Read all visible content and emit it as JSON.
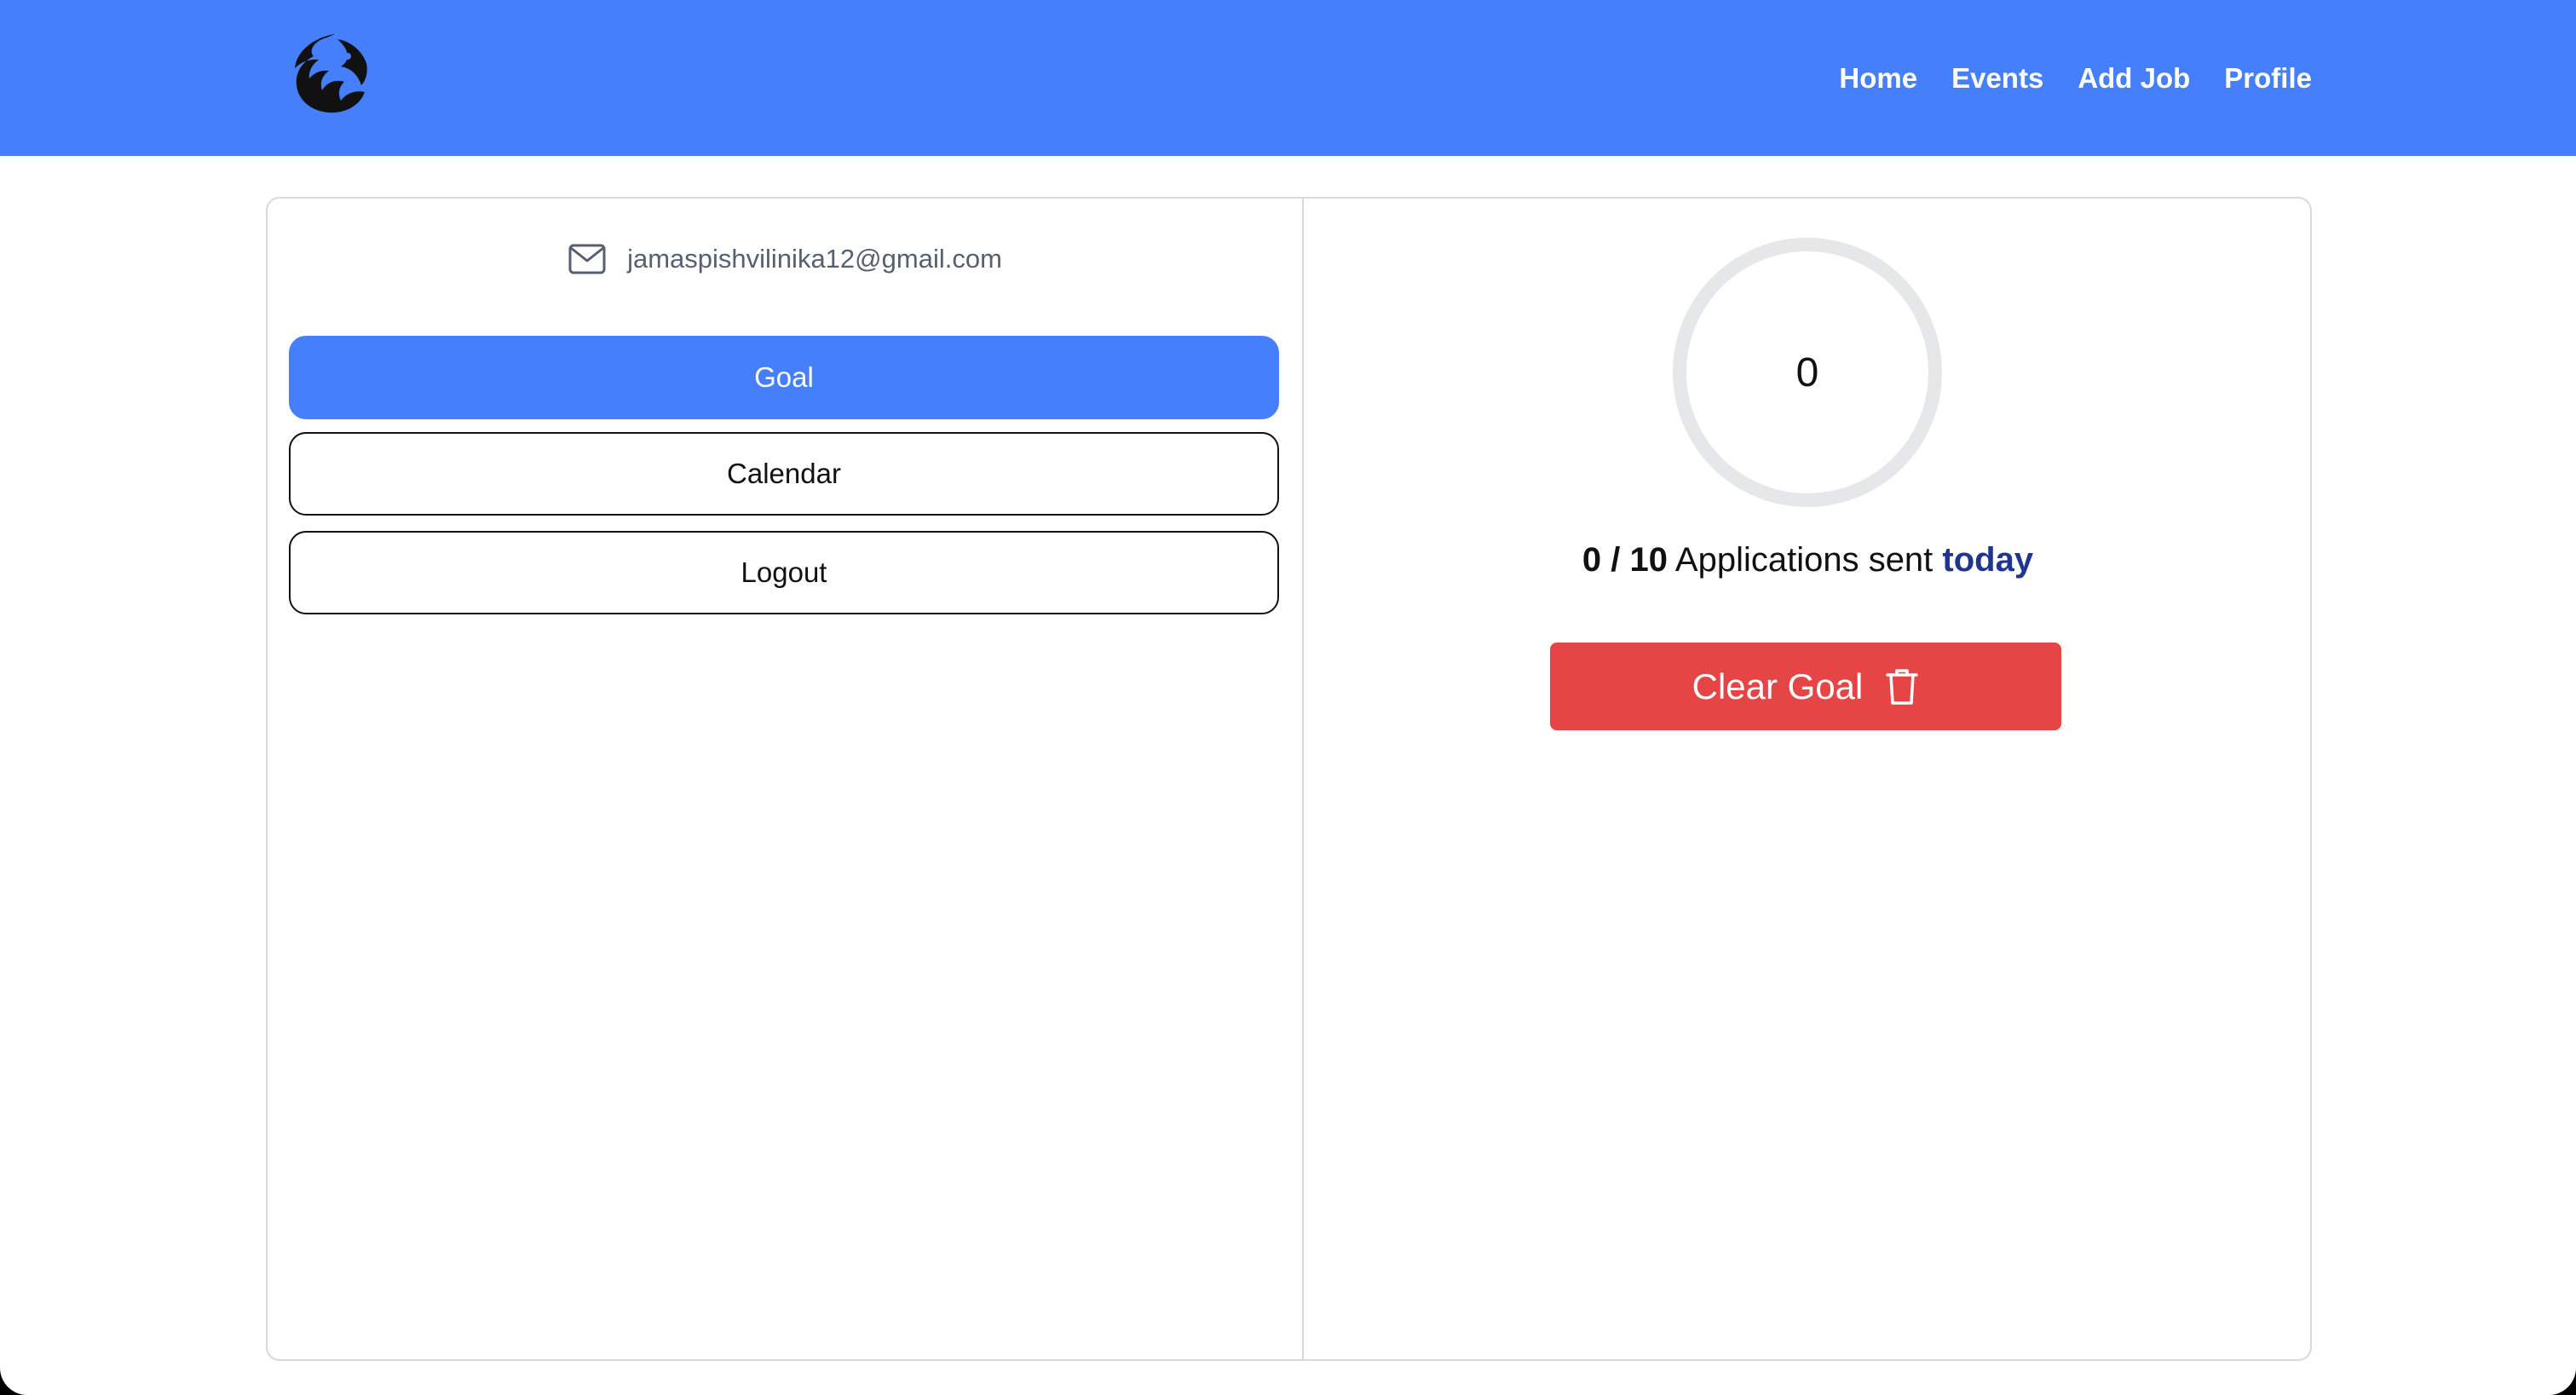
{
  "nav": {
    "logo_icon": "shark-logo-icon",
    "links": [
      "Home",
      "Events",
      "Add Job",
      "Profile"
    ]
  },
  "sidebar": {
    "email_icon": "mail-icon",
    "email": "jamaspishvilinika12@gmail.com",
    "buttons": {
      "goal": "Goal",
      "calendar": "Calendar",
      "logout": "Logout"
    }
  },
  "goal_panel": {
    "progress_value": "0",
    "progress_fraction": 0,
    "sent": "0",
    "separator": " / ",
    "target": "10",
    "label": " Applications sent ",
    "period": "today",
    "clear_label": "Clear Goal",
    "clear_icon": "trash-icon"
  },
  "colors": {
    "brand_blue": "#457ffb",
    "danger_red": "#e64545",
    "accent_navy": "#1f3590",
    "ring_gray": "#e6e7e9"
  }
}
